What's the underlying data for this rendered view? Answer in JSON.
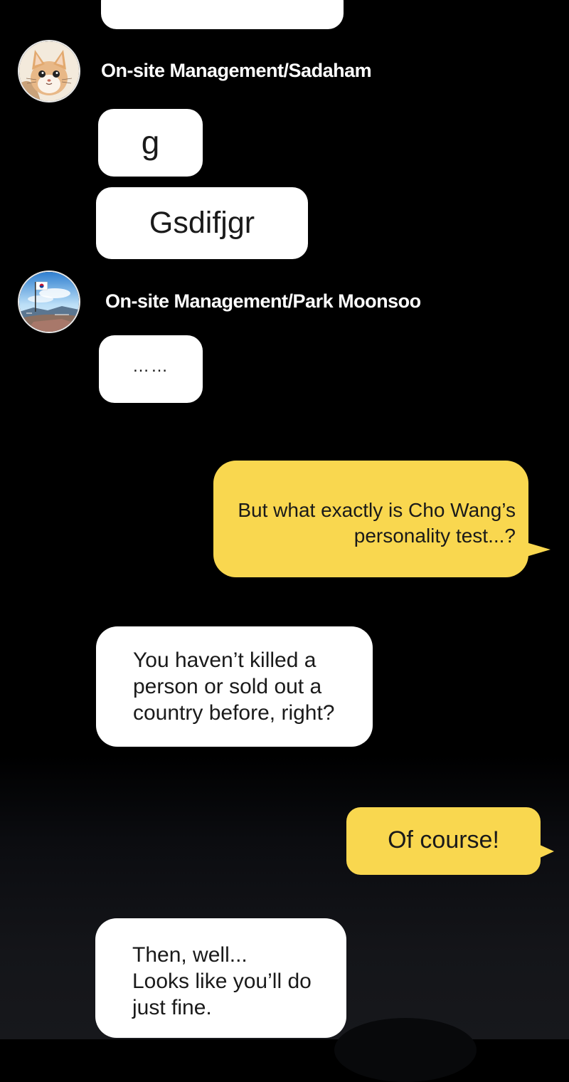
{
  "colors": {
    "background": "#000000",
    "incoming_bubble": "#ffffff",
    "outgoing_bubble": "#f9d74f",
    "sender_name": "#ffffff",
    "text": "#1a1a1a"
  },
  "messages": [
    {
      "type": "incoming",
      "text": ""
    },
    {
      "type": "sender",
      "name": "On-site Management/Sadaham",
      "avatar": "cat-avatar"
    },
    {
      "type": "incoming",
      "text": "g"
    },
    {
      "type": "incoming",
      "text": "Gsdifjgr"
    },
    {
      "type": "sender",
      "name": "On-site Management/Park Moonsoo",
      "avatar": "mountain-flag-avatar"
    },
    {
      "type": "incoming",
      "text": "……"
    },
    {
      "type": "outgoing",
      "text": "But what exactly is Cho Wang’s\npersonality test...?"
    },
    {
      "type": "incoming",
      "text": "You haven’t killed a\nperson or sold out a\ncountry before, right?"
    },
    {
      "type": "outgoing",
      "text": "Of course!"
    },
    {
      "type": "incoming",
      "text": "Then, well...\nLooks like you’ll do\njust fine."
    }
  ]
}
